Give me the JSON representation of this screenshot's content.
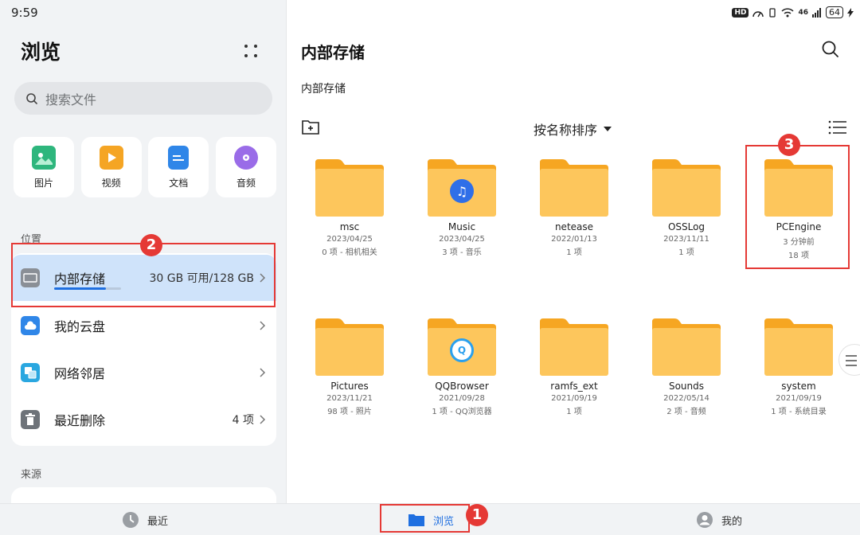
{
  "status_bar": {
    "time": "9:59",
    "hd": "HD",
    "signal": "46",
    "battery": "64"
  },
  "left": {
    "title": "浏览",
    "search_placeholder": "搜索文件",
    "categories": [
      {
        "label": "图片",
        "icon": "image-icon",
        "color": "#2eb67d"
      },
      {
        "label": "视频",
        "icon": "video-icon",
        "color": "#f5a524"
      },
      {
        "label": "文档",
        "icon": "document-icon",
        "color": "#2f86e8"
      },
      {
        "label": "音频",
        "icon": "audio-icon",
        "color": "#9a6ce8"
      }
    ],
    "locations_label": "位置",
    "locations": [
      {
        "label": "内部存储",
        "value": "30 GB 可用/128 GB",
        "icon": "storage-icon",
        "used_fraction": 0.77
      },
      {
        "label": "我的云盘",
        "value": "",
        "icon": "cloud-icon"
      },
      {
        "label": "网络邻居",
        "value": "",
        "icon": "network-icon"
      },
      {
        "label": "最近删除",
        "value": "4 项",
        "icon": "trash-icon"
      }
    ],
    "sources_label": "来源"
  },
  "main": {
    "title": "内部存储",
    "breadcrumb": "内部存储",
    "sort_label": "按名称排序",
    "files": [
      {
        "name": "msc",
        "date": "2023/04/25",
        "meta": "0 项 - 相机相关",
        "badge": ""
      },
      {
        "name": "Music",
        "date": "2023/04/25",
        "meta": "3 项 - 音乐",
        "badge": "music"
      },
      {
        "name": "netease",
        "date": "2022/01/13",
        "meta": "1 项",
        "badge": ""
      },
      {
        "name": "OSSLog",
        "date": "2023/11/11",
        "meta": "1 项",
        "badge": ""
      },
      {
        "name": "PCEngine",
        "date": "3 分钟前",
        "meta": "18 项",
        "badge": ""
      },
      {
        "name": "Pictures",
        "date": "2023/11/21",
        "meta": "98 项 - 照片",
        "badge": ""
      },
      {
        "name": "QQBrowser",
        "date": "2021/09/28",
        "meta": "1 项 - QQ浏览器",
        "badge": "qqbrowser"
      },
      {
        "name": "ramfs_ext",
        "date": "2021/09/19",
        "meta": "1 项",
        "badge": ""
      },
      {
        "name": "Sounds",
        "date": "2022/05/14",
        "meta": "2 项 - 音频",
        "badge": ""
      },
      {
        "name": "system",
        "date": "2021/09/19",
        "meta": "1 项 - 系统目录",
        "badge": ""
      }
    ]
  },
  "bottom_nav": [
    {
      "label": "最近",
      "icon": "clock-icon",
      "active": false
    },
    {
      "label": "浏览",
      "icon": "folder-icon",
      "active": true
    },
    {
      "label": "我的",
      "icon": "user-icon",
      "active": false
    }
  ],
  "annotations": [
    "1",
    "2",
    "3"
  ],
  "colors": {
    "accent": "#1f6fe0",
    "folder": "#fdc65c",
    "folder_tab": "#f6a622",
    "annotation_red": "#e53935",
    "selected_row": "#cfe3fa"
  }
}
